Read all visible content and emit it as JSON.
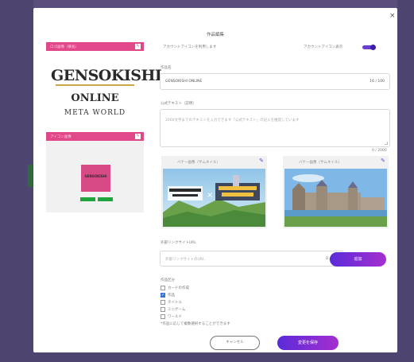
{
  "modal": {
    "close_glyph": "×",
    "title": "作品編集"
  },
  "left": {
    "logo_card_title": "ロゴ画像（横長）",
    "logo": {
      "brand": "GENSOKISHI",
      "subtitle": "ONLINE",
      "tagline": "META WORLD"
    },
    "icon_card_title": "アイコン画像",
    "icon_thumb_text": "GENSOKISHI"
  },
  "right": {
    "account_label": "アカウントアイコンを利用します",
    "toggle_label": "アカウントアイコン表示",
    "name_label": "作品名",
    "name_value": "GENSOKISHI ONLINE",
    "name_count": "16 / 100",
    "desc_label": "公式テキスト（説明）",
    "desc_placeholder": "2000文字までのテキストを入力できます「公式テキスト」の記入を推奨しています",
    "desc_count": "0 / 2000",
    "banner1_title": "バナー画像（サムネイル）",
    "banner2_title": "バナー画像（サムネイル）",
    "url_label": "外部リンクサイトURL",
    "url_placeholder": "外部リンクサイトのURL",
    "url_count": "0 / 300",
    "add_button": "追加",
    "category_label": "作品区分",
    "checkboxes": [
      {
        "label": "カードの作成",
        "checked": false
      },
      {
        "label": "作品",
        "checked": true
      },
      {
        "label": "タイトル",
        "checked": false
      },
      {
        "label": "ミニゲーム",
        "checked": false
      },
      {
        "label": "ワールド",
        "checked": false
      }
    ],
    "note": "*作品に応じて複数選択することができます",
    "cancel_button": "キャンセル",
    "save_button": "変更を保存"
  },
  "colors": {
    "accent_pink": "#e0488a",
    "accent_purple": "#6b3fd6",
    "button_green": "#1ea53b",
    "backdrop": "#5a4e7c"
  },
  "icons": {
    "close": "close-icon",
    "edit": "edit-icon",
    "pen": "pen-icon",
    "check": "check-icon"
  }
}
